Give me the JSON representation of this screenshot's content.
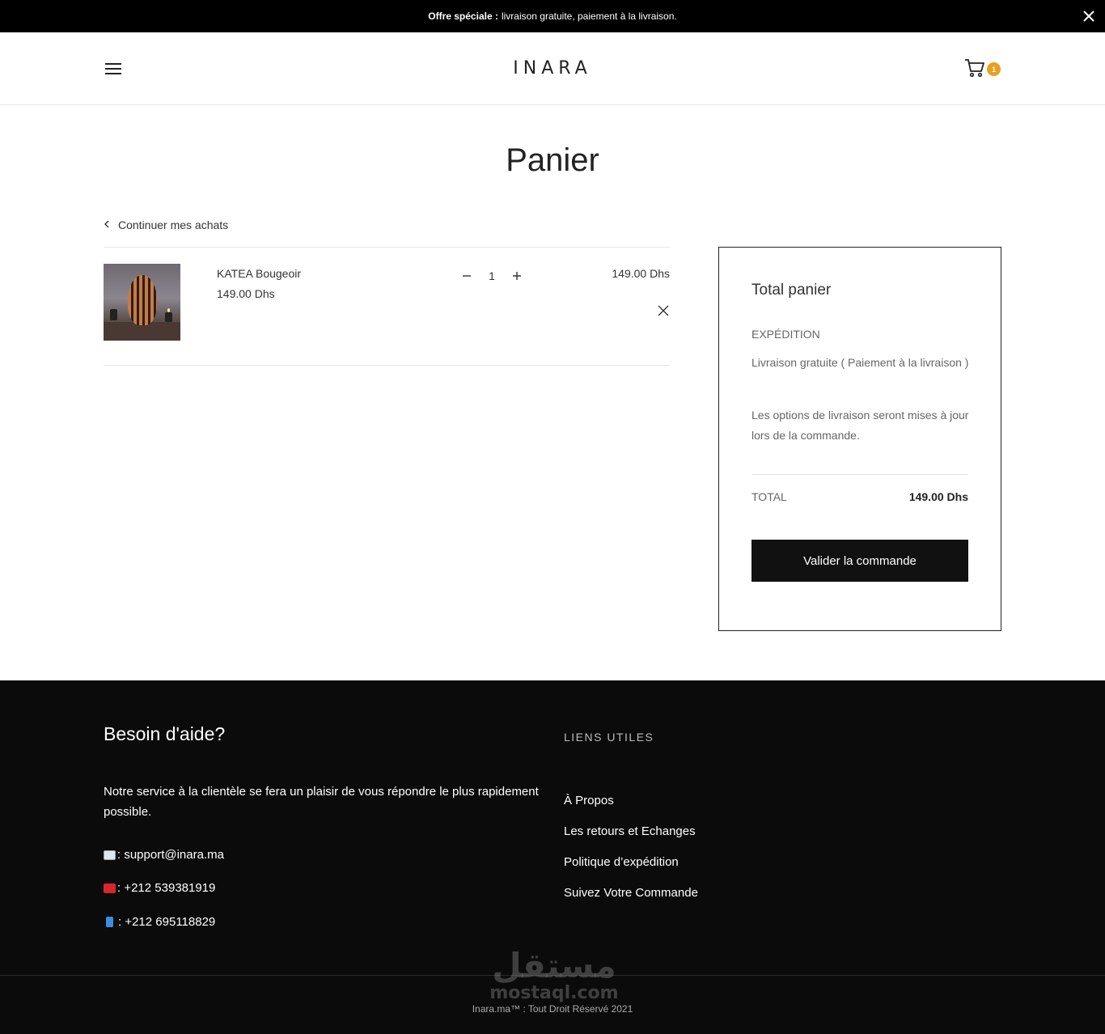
{
  "announcement": {
    "bold": "Offre spéciale :",
    "text": "livraison gratuite, paiement à la livraison."
  },
  "header": {
    "logo": "INARA",
    "cart_count": "1"
  },
  "page": {
    "title": "Panier",
    "continue_label": "Continuer mes achats"
  },
  "cart": {
    "items": [
      {
        "name": "KATEA Bougeoir",
        "price": "149.00 Dhs",
        "quantity": "1",
        "line_total": "149.00 Dhs"
      }
    ]
  },
  "summary": {
    "title": "Total panier",
    "shipping_label": "EXPÉDITION",
    "shipping_option": "Livraison gratuite ( Paiement à la livraison )",
    "shipping_note": "Les options de livraison seront mises à jour lors de la commande.",
    "total_label": "TOTAL",
    "total_value": "149.00 Dhs",
    "checkout_label": "Valider la commande"
  },
  "footer": {
    "help_title": "Besoin d'aide?",
    "help_text": "Notre service à la clientèle se fera un plaisir de vous répondre le plus rapidement possible.",
    "email": ": support@inara.ma",
    "phone": ": +212 539381919",
    "mobile": ": +212 695118829",
    "links_title": "LIENS UTILES",
    "links": [
      "À Propos",
      "Les retours et Echanges",
      "Politique d’expédition",
      "Suivez Votre Commande"
    ],
    "copyright": "Inara.ma™ : Tout Droit Réservé 2021",
    "watermark_ar": "مستقل",
    "watermark_lat": "mostaql.com"
  },
  "colors": {
    "accent": "#e8a01e",
    "dark": "#111111",
    "footer_bg": "#0b0b0b"
  }
}
